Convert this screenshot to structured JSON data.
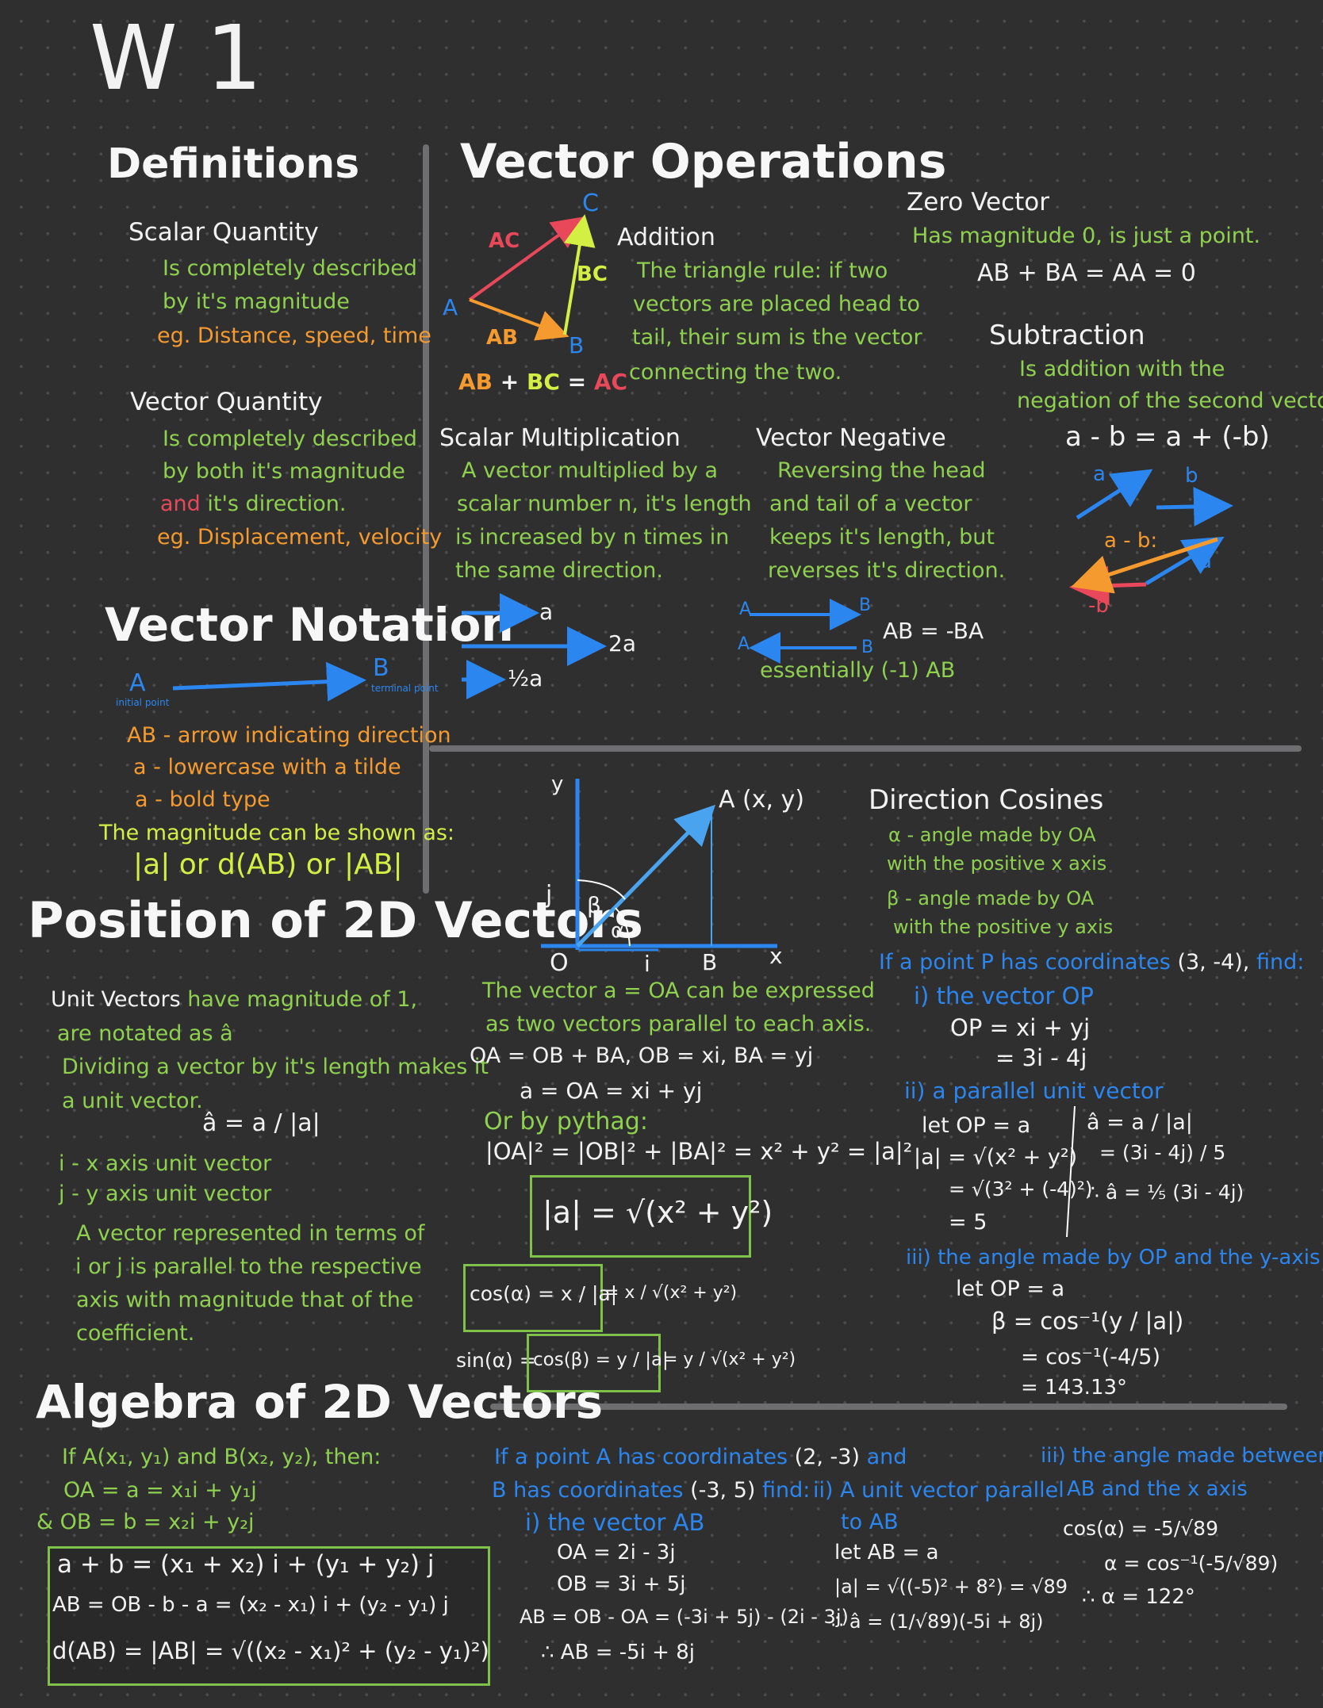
{
  "page_title": "W 1",
  "definitions": {
    "heading": "Definitions",
    "scalar": {
      "title": "Scalar Quantity",
      "lines": [
        "Is completely described",
        "by it's magnitude"
      ],
      "eg": "eg. Distance, speed, time"
    },
    "vector": {
      "title": "Vector Quantity",
      "lines": [
        "Is completely described",
        "by both it's magnitude"
      ],
      "line3_and": "and",
      "line3_rest": "it's direction.",
      "eg": "eg. Displacement, velocity"
    }
  },
  "notation": {
    "heading": "Vector Notation",
    "point_a": "A",
    "point_b": "B",
    "initial": "initial point",
    "terminal": "terminal point",
    "items": [
      "AB - arrow indicating direction",
      "a - lowercase with a tilde",
      "a - bold type"
    ],
    "magnitude_text": "The magnitude can be shown as:",
    "magnitude_forms": "|a| or d(AB) or |AB|"
  },
  "operations": {
    "heading": "Vector Operations",
    "triangle": {
      "label_a": "A",
      "label_b": "B",
      "label_c": "C",
      "ac": "AC",
      "bc": "BC",
      "ab": "AB",
      "eq_ab": "AB",
      "eq_plus": "+",
      "eq_bc": "BC",
      "eq_eq": "=",
      "eq_ac": "AC"
    },
    "addition": {
      "title": "Addition",
      "lines": [
        "The triangle rule: if two",
        "vectors are placed head to",
        "tail, their sum is the vector",
        "connecting the two."
      ]
    },
    "zero": {
      "title": "Zero Vector",
      "desc": "Has magnitude 0, is just a point.",
      "eq": "AB + BA = AA = 0"
    },
    "subtraction": {
      "title": "Subtraction",
      "lines": [
        "Is addition with the",
        "negation of the second vector."
      ],
      "eq": "a - b = a + (-b)",
      "label_a": "a",
      "label_b": "b",
      "label_diff": "a - b:",
      "label_a2": "a",
      "label_negb": "-b"
    },
    "scalar_mult": {
      "title": "Scalar Multiplication",
      "lines": [
        "A vector multiplied by a",
        "scalar number n, it's length",
        "is increased by n times in",
        "the same direction."
      ],
      "labels": [
        "a",
        "2a",
        "½a"
      ]
    },
    "negative": {
      "title": "Vector Negative",
      "lines": [
        "Reversing the head",
        "and tail of a vector",
        "keeps it's length, but",
        "reverses it's direction."
      ],
      "a": "A",
      "b": "B",
      "eq": "AB = -BA",
      "essentially": "essentially (-1) AB"
    }
  },
  "position": {
    "heading": "Position of 2D Vectors",
    "unit_lead": "Unit Vectors",
    "unit_lines": [
      "have magnitude of 1,",
      "are notated as â",
      "Dividing a vector by it's length makes it",
      "a unit vector."
    ],
    "unit_formula": "â = a / |a|",
    "i_text": "i - x axis unit vector",
    "j_text": "j - y axis unit vector",
    "rep_lines": [
      "A vector represented in terms of",
      "i or j  is parallel to the respective",
      "axis with magnitude that of the",
      "coefficient."
    ],
    "graph": {
      "y": "y",
      "x": "x",
      "o": "O",
      "b": "B",
      "a": "A (x, y)",
      "i": "i",
      "j": "j",
      "alpha": "α",
      "beta": "β"
    },
    "expr_lines": [
      "The vector  a = OA  can be expressed",
      "as two vectors parallel to each axis."
    ],
    "eq1": "OA = OB + BA,  OB = xi,  BA = yj",
    "eq2": "a = OA = xi + yj",
    "pythag": "Or by pythag:",
    "eq3": "|OA|² = |OB|² + |BA|² = x² + y² = |a|²",
    "boxed": "|a| = √(x² + y²)",
    "cos_box": "cos(α) = x / |a|",
    "cos_rest": "= x / √(x² + y²)",
    "sin_lead": "sin(α) =",
    "sin_box": "cos(β) = y / |a|",
    "sin_rest": "= y / √(x² + y²)"
  },
  "direction_cosines": {
    "title": "Direction Cosines",
    "alpha_lines": [
      "α - angle made by OA",
      "with the positive x axis"
    ],
    "beta_lines": [
      "β - angle made by OA",
      "with the positive y axis"
    ],
    "problem_lead": "If a point P has coordinates",
    "problem_coords": "(3, -4),",
    "problem_find": "find:",
    "part1": "i) the vector OP",
    "part1_eq1": "OP = xi + yj",
    "part1_eq2": "= 3i - 4j",
    "part2": "ii) a parallel unit vector",
    "part2_left": [
      "let OP = a",
      "|a| = √(x² + y²)",
      "= √(3² + (-4)²)",
      "= 5"
    ],
    "part2_right": [
      "â = a / |a|",
      "= (3i - 4j) / 5",
      "∴ â = ⅕ (3i - 4j)"
    ],
    "part3": "iii) the angle made by OP and the y-axis",
    "part3_lines": [
      "let OP = a",
      "β = cos⁻¹(y / |a|)",
      "= cos⁻¹(-4/5)",
      "= 143.13°"
    ]
  },
  "algebra": {
    "heading": "Algebra of 2D Vectors",
    "lines": [
      "If A(x₁, y₁) and B(x₂, y₂), then:",
      "OA = a = x₁i + y₁j",
      "& OB = b = x₂i + y₂j"
    ],
    "boxed": [
      "a + b = (x₁ + x₂) i + (y₁ + y₂) j",
      "AB = OB - b - a = (x₂ - x₁) i + (y₂ - y₁) j",
      "d(AB) = |AB| = √((x₂ - x₁)² + (y₂ - y₁)²)"
    ],
    "ex_lead": "If a point A has coordinates",
    "ex_coords_a": "(2, -3)",
    "ex_and": "and",
    "ex_b_lead": "B has coordinates",
    "ex_coords_b": "(-3, 5)",
    "ex_find": "find:",
    "ex_part1": "i) the vector AB",
    "ex_part1_lines": [
      "OA = 2i - 3j",
      "OB = 3i + 5j",
      "AB = OB - OA = (-3i + 5j) - (2i - 3j)",
      "∴ AB = -5i + 8j"
    ],
    "ex_part2": [
      "ii) A unit vector parallel",
      "to AB"
    ],
    "ex_part2_lines": [
      "let AB = a",
      "|a| = √((-5)² + 8²) = √89",
      "∴ â = (1/√89)(-5i + 8j)"
    ],
    "ex_part3": [
      "iii) the angle made between",
      "AB and the x axis"
    ],
    "ex_part3_lines": [
      "cos(α) = -5/√89",
      "α = cos⁻¹(-5/√89)",
      "∴ α = 122°"
    ]
  }
}
